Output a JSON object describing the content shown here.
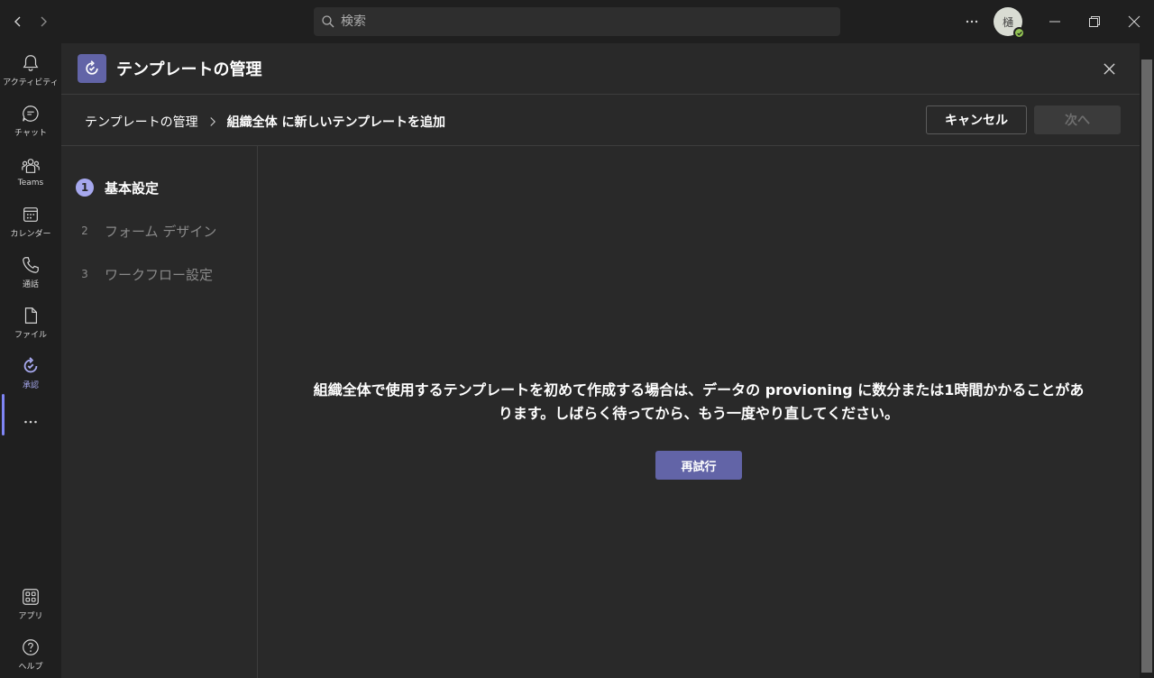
{
  "titlebar": {
    "search_placeholder": "検索",
    "avatar_initial": "樋"
  },
  "rail": {
    "items": [
      {
        "label": "アクティビティ",
        "icon": "bell-icon"
      },
      {
        "label": "チャット",
        "icon": "chat-icon"
      },
      {
        "label": "Teams",
        "icon": "teams-icon"
      },
      {
        "label": "カレンダー",
        "icon": "calendar-icon"
      },
      {
        "label": "通話",
        "icon": "phone-icon"
      },
      {
        "label": "ファイル",
        "icon": "file-icon"
      },
      {
        "label": "承認",
        "icon": "approvals-icon",
        "active": true
      },
      {
        "label": "",
        "icon": "more-icon"
      },
      {
        "label": "アプリ",
        "icon": "apps-icon"
      },
      {
        "label": "ヘルプ",
        "icon": "help-icon"
      }
    ]
  },
  "header": {
    "title": "テンプレートの管理"
  },
  "breadcrumb": {
    "parent": "テンプレートの管理",
    "current": "組織全体 に新しいテンプレートを追加"
  },
  "actions": {
    "cancel_label": "キャンセル",
    "next_label": "次へ"
  },
  "steps": [
    {
      "num": "1",
      "label": "基本設定",
      "active": true
    },
    {
      "num": "2",
      "label": "フォーム デザイン",
      "active": false
    },
    {
      "num": "3",
      "label": "ワークフロー設定",
      "active": false
    }
  ],
  "content": {
    "message_line1": "組織全体で使用するテンプレートを初めて作成する場合は、データの provioning に数分または1時間かかることがあ",
    "message_line2": "ります。しばらく待ってから、もう一度やり直してください。",
    "retry_label": "再試行"
  },
  "colors": {
    "accent": "#6264a7",
    "accent_light": "#a6a8ee",
    "background": "#292929",
    "rail": "#1f1f1f"
  }
}
